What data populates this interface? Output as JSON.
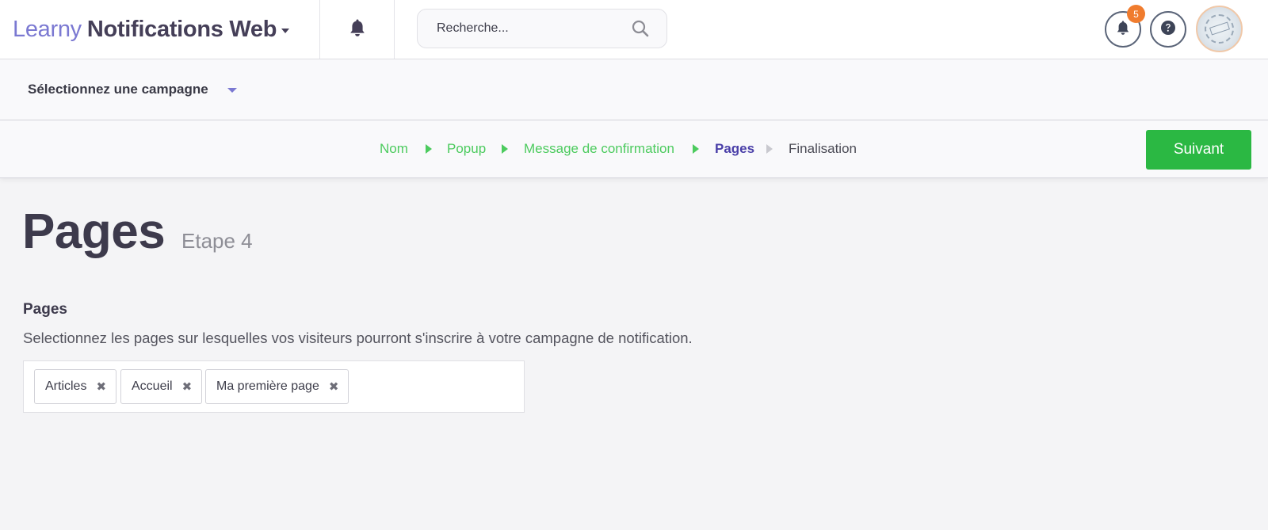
{
  "header": {
    "brand_primary": "Learny",
    "brand_secondary": "Notifications Web",
    "search_placeholder": "Recherche...",
    "notification_count": "5",
    "icons": {
      "brand_menu": "chevron-down-icon",
      "bell": "bell-icon",
      "search": "search-icon",
      "notifications": "bell-icon",
      "help": "question-circle-icon"
    }
  },
  "campaign": {
    "selector_label": "Sélectionnez une campagne"
  },
  "steps": {
    "items": [
      {
        "label": "Nom",
        "state": "done"
      },
      {
        "label": "Popup",
        "state": "done"
      },
      {
        "label": "Message de confirmation",
        "state": "done"
      },
      {
        "label": "Pages",
        "state": "current"
      },
      {
        "label": "Finalisation",
        "state": "todo"
      }
    ],
    "next_label": "Suivant"
  },
  "page": {
    "title": "Pages",
    "step_label": "Etape 4"
  },
  "section": {
    "title": "Pages",
    "description": "Selectionnez les pages sur lesquelles vos visiteurs pourront s'inscrire à votre campagne de notification.",
    "tags": [
      "Articles",
      "Accueil",
      "Ma première page"
    ],
    "remove_symbol": "✖"
  },
  "colors": {
    "brand_accent": "#7b79d2",
    "step_done": "#4ccb5e",
    "step_current": "#4a3fa8",
    "next_button": "#2bb843",
    "badge": "#f07c2e"
  }
}
